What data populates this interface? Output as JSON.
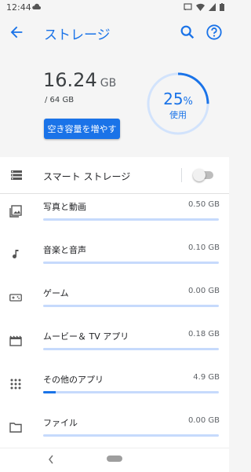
{
  "status_bar": {
    "time": "12:44",
    "left_icon": "cloud-icon",
    "right_icons": [
      "cast-icon",
      "wifi-icon",
      "signal-icon",
      "battery-icon"
    ]
  },
  "app_bar": {
    "title": "ストレージ",
    "icons": [
      "back-arrow-icon",
      "search-icon",
      "help-icon"
    ]
  },
  "summary": {
    "used_value": "16.24",
    "used_unit": "GB",
    "total": "/ 64 GB",
    "free_space_button": "空き容量を増やす",
    "gauge_percent_value": "25",
    "gauge_percent_sign": "%",
    "gauge_label": "使用",
    "gauge_fraction": 0.25
  },
  "smart_storage": {
    "label": "スマート ストレージ",
    "enabled": false
  },
  "categories": [
    {
      "icon": "photo-icon",
      "label": "写真と動画",
      "size": "0.50 GB",
      "fill": 0.0
    },
    {
      "icon": "music-note-icon",
      "label": "音楽と音声",
      "size": "0.10 GB",
      "fill": 0.0
    },
    {
      "icon": "gamepad-icon",
      "label": "ゲーム",
      "size": "0.00 GB",
      "fill": 0.0
    },
    {
      "icon": "movie-icon",
      "label": "ムービー＆ TV アプリ",
      "size": "0.18 GB",
      "fill": 0.0
    },
    {
      "icon": "apps-grid-icon",
      "label": "その他のアプリ",
      "size": "4.9 GB",
      "fill": 0.07
    },
    {
      "icon": "folder-icon",
      "label": "ファイル",
      "size": "0.00 GB",
      "fill": 0.0
    }
  ],
  "colors": {
    "accent": "#1a73e8",
    "bar_track": "#c6dafc",
    "gauge_track": "#d2e3fc"
  }
}
